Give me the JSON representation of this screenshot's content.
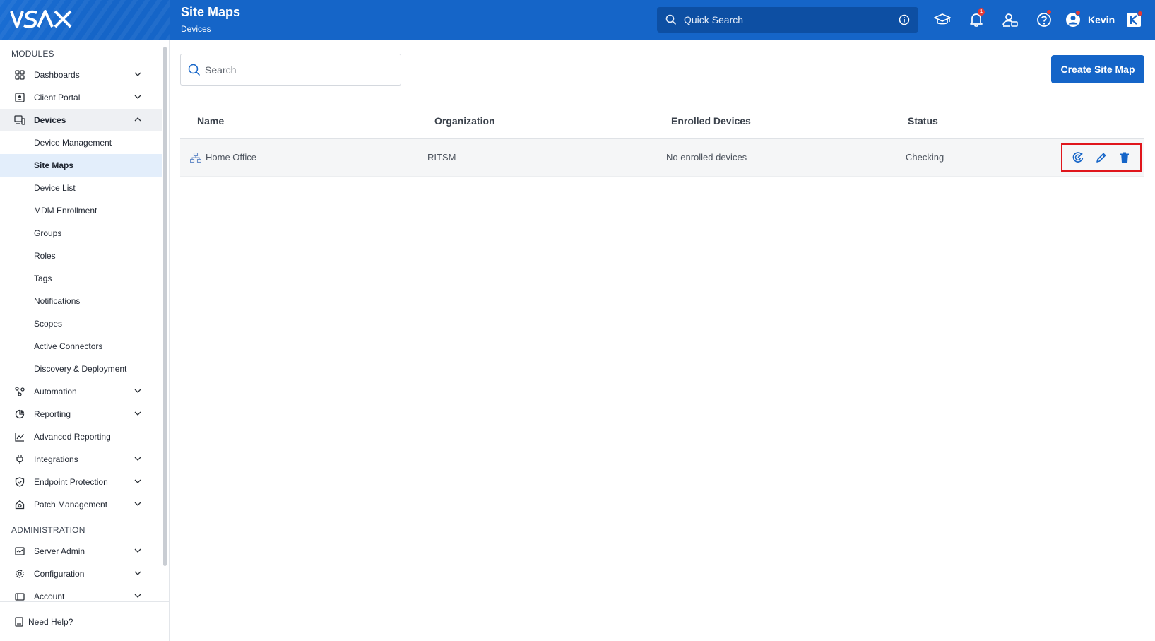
{
  "app": {
    "logo": "VSAX"
  },
  "header": {
    "title": "Site Maps",
    "subtitle": "Devices"
  },
  "quick_search": {
    "placeholder": "Quick Search"
  },
  "top_icons": {
    "notification_count": "1"
  },
  "user": {
    "name": "Kevin"
  },
  "sidebar": {
    "modules_label": "MODULES",
    "modules": [
      {
        "label": "Dashboards"
      },
      {
        "label": "Client Portal"
      },
      {
        "label": "Devices"
      }
    ],
    "devices_sub": [
      "Device Management",
      "Site Maps",
      "Device List",
      "MDM Enrollment",
      "Groups",
      "Roles",
      "Tags",
      "Notifications",
      "Scopes",
      "Active Connectors",
      "Discovery & Deployment"
    ],
    "modules_after": [
      {
        "label": "Automation"
      },
      {
        "label": "Reporting"
      },
      {
        "label": "Advanced Reporting"
      },
      {
        "label": "Integrations"
      },
      {
        "label": "Endpoint Protection"
      },
      {
        "label": "Patch Management"
      }
    ],
    "admin_label": "ADMINISTRATION",
    "admin": [
      {
        "label": "Server Admin"
      },
      {
        "label": "Configuration"
      },
      {
        "label": "Account"
      }
    ],
    "help": "Need Help?"
  },
  "main": {
    "search_placeholder": "Search",
    "create_button": "Create Site Map",
    "columns": [
      "Name",
      "Organization",
      "Enrolled Devices",
      "Status"
    ],
    "rows": [
      {
        "name": "Home Office",
        "organization": "RITSM",
        "enrolled": "No enrolled devices",
        "status": "Checking"
      }
    ]
  },
  "colors": {
    "brand": "#1565c8",
    "highlight": "#e0161c",
    "active_bg": "#e3eefb"
  }
}
